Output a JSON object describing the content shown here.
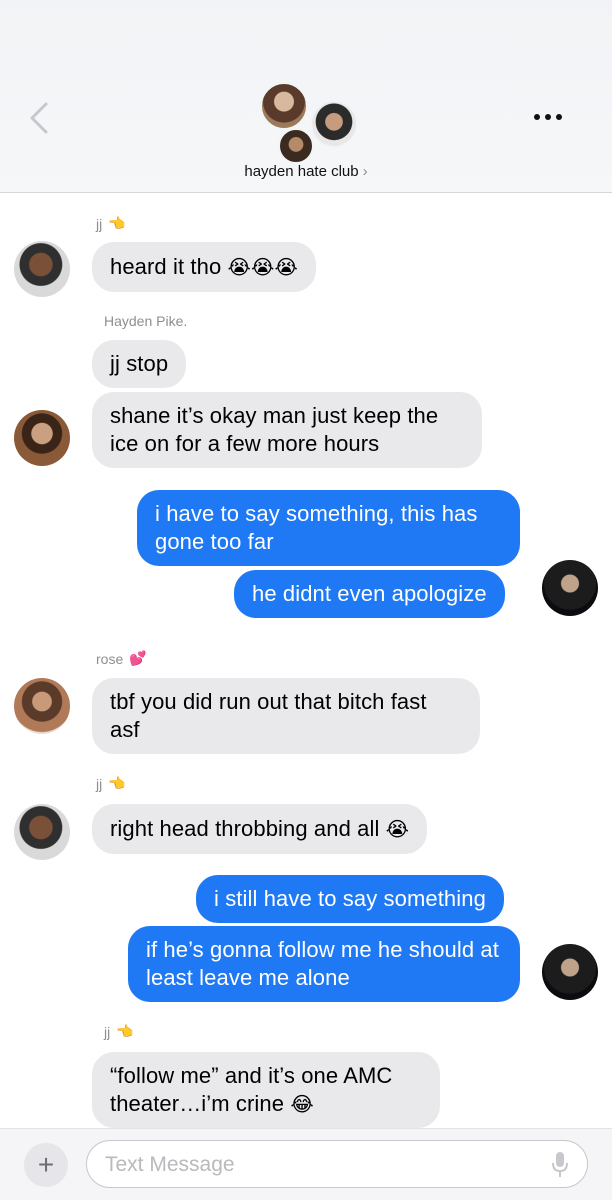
{
  "header": {
    "group_name": "hayden hate club",
    "chevron": "›",
    "icons": [
      "back-chevron-icon",
      "more-dots-icon"
    ]
  },
  "messages": [
    {
      "sender": "jj",
      "sender_emoji": "👈",
      "text": "heard it tho",
      "emoji": "😭😭😭"
    },
    {
      "sender": "Hayden Pike.",
      "text": "jj stop"
    },
    {
      "text": "shane it’s okay man just keep the ice on for a few more hours"
    },
    {
      "outgoing": true,
      "text": "i have to say something, this has gone too far"
    },
    {
      "outgoing": true,
      "text": "he didnt even apologize"
    },
    {
      "sender": "rose",
      "sender_emoji": "💕",
      "text": "tbf you did run out that bitch fast asf"
    },
    {
      "sender": "jj",
      "sender_emoji": "👈",
      "text": "right head throbbing and all",
      "emoji": "😭"
    },
    {
      "outgoing": true,
      "text": "i still have to say something"
    },
    {
      "outgoing": true,
      "text": "if he’s gonna follow me he should at least leave me alone"
    },
    {
      "sender": "jj",
      "sender_emoji": "👈",
      "text": "“follow me” and it’s one AMC theater…i’m crine",
      "emoji": "😂"
    }
  ],
  "input": {
    "placeholder": "Text Message",
    "plus_label": "+"
  },
  "colors": {
    "outgoing_bubble": "#1f79f5",
    "incoming_bubble": "#e9e9eb"
  }
}
